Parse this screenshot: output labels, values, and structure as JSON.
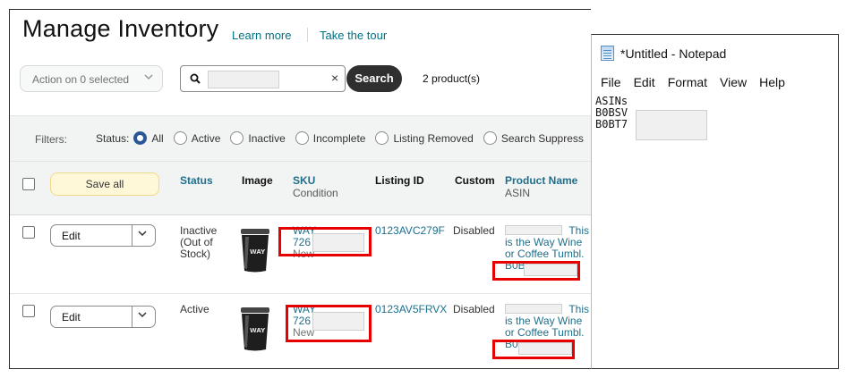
{
  "page": {
    "title": "Manage Inventory",
    "learn_more": "Learn more",
    "take_tour": "Take the tour"
  },
  "toolbar": {
    "action_label": "Action on 0 selected",
    "search_value": "",
    "clear_glyph": "×",
    "search_button": "Search",
    "product_count": "2 product(s)"
  },
  "filters": {
    "label": "Filters:",
    "status_label": "Status:",
    "options": [
      "All",
      "Active",
      "Inactive",
      "Incomplete",
      "Listing Removed",
      "Search Suppress"
    ],
    "selected": "All"
  },
  "table": {
    "save_all": "Save all",
    "headers": {
      "status": "Status",
      "image": "Image",
      "sku": "SKU",
      "sku_sub": "Condition",
      "listing_id": "Listing ID",
      "custom": "Custom",
      "product_name": "Product Name",
      "product_name_sub": "ASIN"
    },
    "rows": [
      {
        "edit_label": "Edit",
        "status_line1": "Inactive",
        "status_line2": "(Out of",
        "status_line3": "Stock)",
        "sku_line1": "WAY",
        "sku_line2": "726",
        "condition": "New",
        "listing_id": "0123AVC279F",
        "custom": "Disabled",
        "name_line1": "This",
        "name_line2": "is the Way Wine",
        "name_line3": "or Coffee Tumbl.",
        "asin": "B0B"
      },
      {
        "edit_label": "Edit",
        "status_line1": "Active",
        "sku_line1": "WAY",
        "sku_line2": "726",
        "condition": "New",
        "listing_id": "0123AV5FRVX",
        "custom": "Disabled",
        "name_line1": "This",
        "name_line2": "is the Way Wine",
        "name_line3": "or Coffee Tumbl.",
        "asin": "B0"
      }
    ]
  },
  "notepad": {
    "title": "*Untitled - Notepad",
    "menu": [
      "File",
      "Edit",
      "Format",
      "View",
      "Help"
    ],
    "lines": [
      "ASINs",
      "B0BSV",
      "B0BT7"
    ]
  },
  "colors": {
    "link": "#007185",
    "teal_header": "#1f6f8b",
    "search_button_bg": "#2f2f2f",
    "highlight_red": "#e60000",
    "radio_selected": "#2b5797",
    "save_all_bg": "#fff8d8"
  },
  "icons": {
    "search": "magnifier-icon",
    "dropdown": "chevron-down-icon",
    "notepad": "notepad-icon"
  }
}
